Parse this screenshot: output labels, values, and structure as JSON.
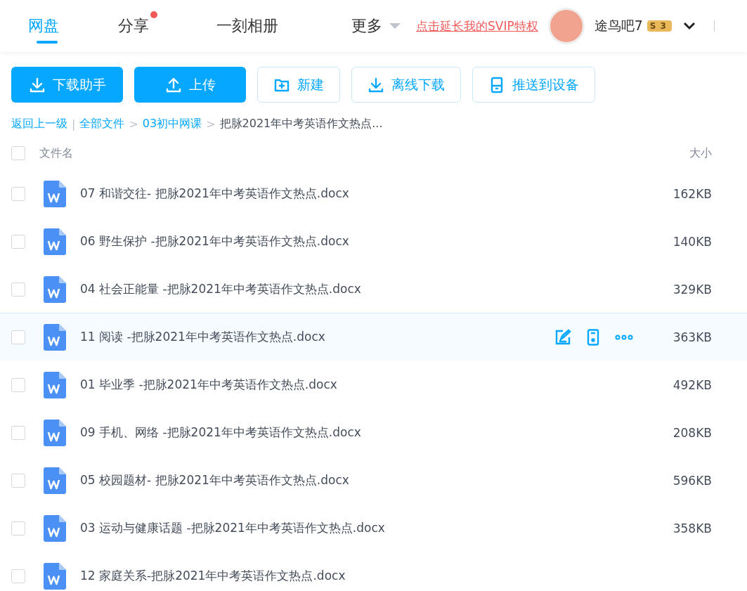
{
  "nav": {
    "tabs": [
      {
        "label": "网盘",
        "selected": true,
        "dot": false,
        "dropdown": false
      },
      {
        "label": "分享",
        "selected": false,
        "dot": true,
        "dropdown": false
      },
      {
        "label": "一刻相册",
        "selected": false,
        "dot": false,
        "dropdown": false
      },
      {
        "label": "更多",
        "selected": false,
        "dot": false,
        "dropdown": true
      }
    ],
    "promo_link": "点击延长我的SVIP特权",
    "user": {
      "name": "途鸟吧7",
      "badge_letter": "S",
      "badge_level": "3"
    }
  },
  "toolbar": [
    {
      "label": "下载助手",
      "kind": "primary"
    },
    {
      "label": "上传",
      "kind": "primary"
    },
    {
      "label": "新建",
      "kind": "outline"
    },
    {
      "label": "离线下载",
      "kind": "outline"
    },
    {
      "label": "推送到设备",
      "kind": "outline"
    }
  ],
  "breadcrumb": {
    "back": "返回上一级",
    "divider": "|",
    "items": [
      {
        "label": "全部文件",
        "current": false
      },
      {
        "separator": ">",
        "label": "03初中网课",
        "current": false
      },
      {
        "separator": ">",
        "label": "把脉2021年中考英语作文热点...",
        "current": true
      }
    ]
  },
  "table": {
    "columns": [
      "文件名",
      "大小"
    ],
    "select_all": false,
    "rows": [
      {
        "name": "07 和谐交往- 把脉2021年中考英语作文热点.docx",
        "size": "162KB",
        "checked": false,
        "hovered": false
      },
      {
        "name": "06 野生保护 -把脉2021年中考英语作文热点.docx",
        "size": "140KB",
        "checked": false,
        "hovered": false
      },
      {
        "name": "04 社会正能量 -把脉2021年中考英语作文热点.docx",
        "size": "329KB",
        "checked": false,
        "hovered": false
      },
      {
        "name": "11 阅读 -把脉2021年中考英语作文热点.docx",
        "size": "363KB",
        "checked": false,
        "hovered": true
      },
      {
        "name": "01 毕业季 -把脉2021年中考英语作文热点.docx",
        "size": "492KB",
        "checked": false,
        "hovered": false
      },
      {
        "name": "09 手机、网络 -把脉2021年中考英语作文热点.docx",
        "size": "208KB",
        "checked": false,
        "hovered": false
      },
      {
        "name": "05 校园题材- 把脉2021年中考英语作文热点.docx",
        "size": "596KB",
        "checked": false,
        "hovered": false
      },
      {
        "name": "03 运动与健康话题 -把脉2021年中考英语作文热点.docx",
        "size": "358KB",
        "checked": false,
        "hovered": false
      },
      {
        "name": "12 家庭关系-把脉2021年中考英语作文热点.docx",
        "checked": false,
        "hovered": false
      }
    ]
  }
}
